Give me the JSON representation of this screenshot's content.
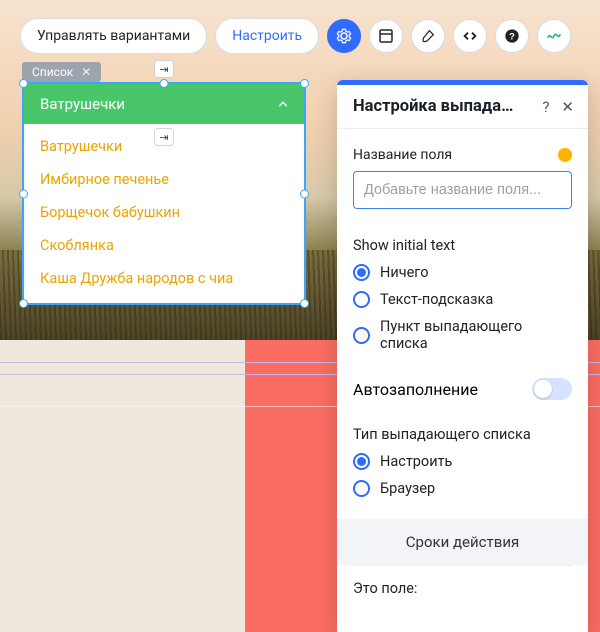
{
  "toolbar": {
    "manage_variants": "Управлять вариантами",
    "configure": "Настроить",
    "icons": [
      "gear",
      "layout",
      "brush",
      "code",
      "help",
      "squiggle"
    ]
  },
  "list_chip": {
    "label": "Список"
  },
  "dropdown": {
    "selected": "Ватрушечки",
    "items": [
      "Ватрушечки",
      "Имбирное печенье",
      "Борщечок бабушкин",
      "Скоблянка",
      "Каша Дружба народов с чиа"
    ]
  },
  "panel": {
    "title": "Настройка выпадаю...",
    "field_label": "Название поля",
    "field_placeholder": "Добавьте название поля...",
    "show_initial_title": "Show initial text",
    "show_initial_options": [
      "Ничего",
      "Текст-подсказка",
      "Пункт выпадающего списка"
    ],
    "show_initial_selected": 0,
    "autofill_label": "Автозаполнение",
    "autofill_on": false,
    "type_title": "Тип выпадающего списка",
    "type_options": [
      "Настроить",
      "Браузер"
    ],
    "type_selected": 0,
    "cta": "Сроки действия",
    "footer": "Это поле:"
  }
}
